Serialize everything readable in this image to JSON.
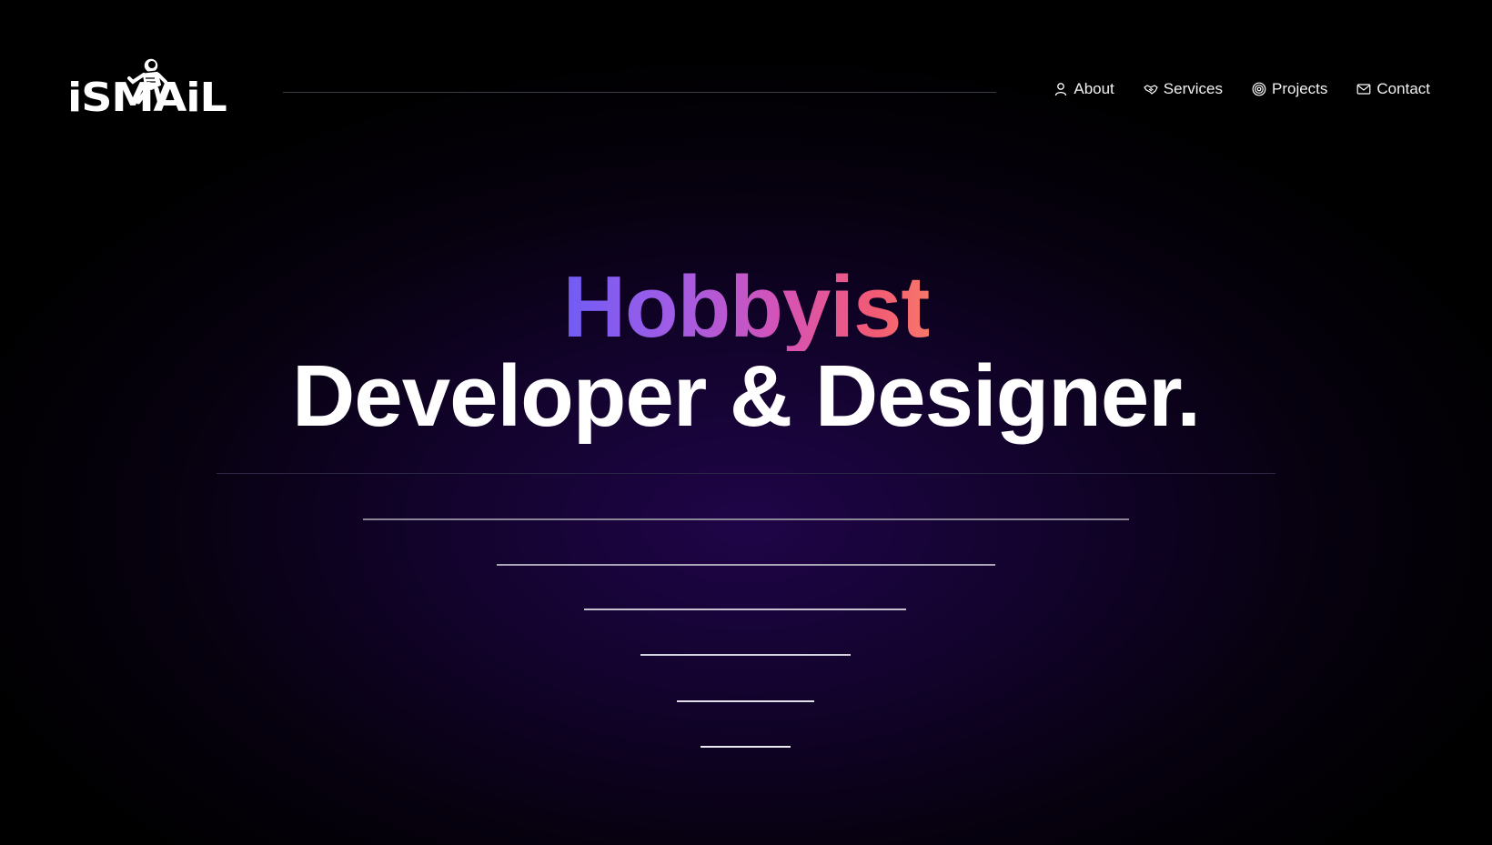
{
  "brand": {
    "logo_text": "iSMAiL",
    "logo_icon": "astronaut-icon"
  },
  "nav": {
    "items": [
      {
        "label": "About",
        "icon": "user-icon"
      },
      {
        "label": "Services",
        "icon": "handshake-icon"
      },
      {
        "label": "Projects",
        "icon": "target-icon"
      },
      {
        "label": "Contact",
        "icon": "mail-icon"
      }
    ]
  },
  "hero": {
    "line1": "Hobbyist",
    "line2": "Developer & Designer."
  },
  "colors": {
    "gradient": [
      "#6f5cf5",
      "#a15ce6",
      "#d653b6",
      "#f25a74",
      "#f7776a"
    ],
    "background_glow": "#1f0548"
  }
}
